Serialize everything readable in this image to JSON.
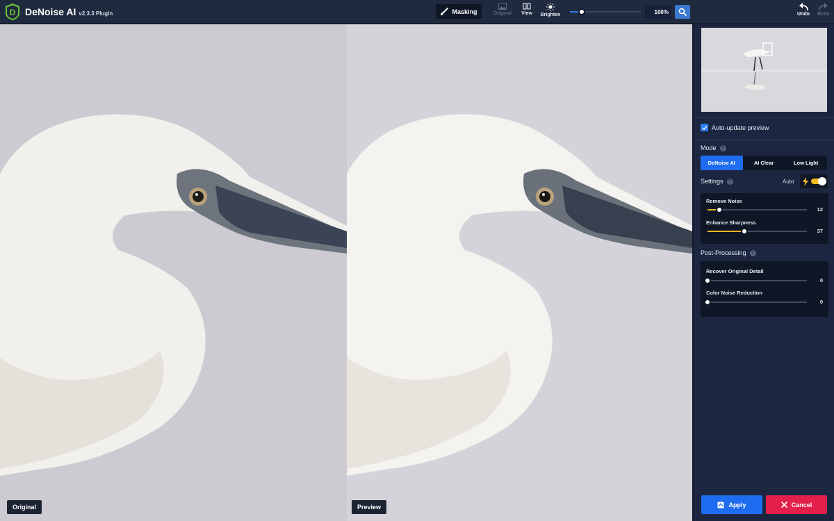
{
  "app": {
    "title": "DeNoise AI",
    "version": "v2.3.3 Plugin",
    "logo_letter": "D"
  },
  "toolbar": {
    "masking_label": "Masking",
    "original_label": "Original",
    "view_label": "View",
    "brighten_label": "Brighten",
    "zoom_level": "100%",
    "zoom_slider_fraction": 0.17,
    "undo_label": "Undo",
    "redo_label": "Redo"
  },
  "panes": {
    "original_label": "Original",
    "preview_label": "Preview"
  },
  "panel": {
    "auto_update_label": "Auto-update preview",
    "auto_update_checked": true,
    "mode": {
      "title": "Mode",
      "options": [
        "DeNoise AI",
        "AI Clear",
        "Low Light"
      ],
      "selected": "DeNoise AI"
    },
    "settings": {
      "title": "Settings",
      "auto_label": "Auto",
      "auto_enabled": true,
      "remove_noise": {
        "label": "Remove Noise",
        "value": "12",
        "fraction": 0.12
      },
      "enhance_sharpness": {
        "label": "Enhance Sharpness",
        "value": "37",
        "fraction": 0.37
      }
    },
    "post_processing": {
      "title": "Post-Processing",
      "recover_detail": {
        "label": "Recover Original Detail",
        "value": "0",
        "fraction": 0
      },
      "color_noise": {
        "label": "Color Noise Reduction",
        "value": "0",
        "fraction": 0
      }
    },
    "apply_label": "Apply",
    "cancel_label": "Cancel"
  },
  "colors": {
    "accent": "#1e6df0",
    "slider_fill": "#f0b52a",
    "cancel": "#e3204a",
    "logo": "#6dc23f"
  },
  "icons": {
    "logo": "denoise-logo-icon",
    "masking": "brush-icon",
    "original": "image-icon",
    "view": "split-view-icon",
    "brighten": "sun-icon",
    "zoom": "magnifier-icon",
    "undo": "undo-arrow-icon",
    "redo": "redo-arrow-icon",
    "help": "question-icon",
    "auto": "lightning-icon",
    "apply": "save-icon",
    "cancel": "close-icon"
  }
}
